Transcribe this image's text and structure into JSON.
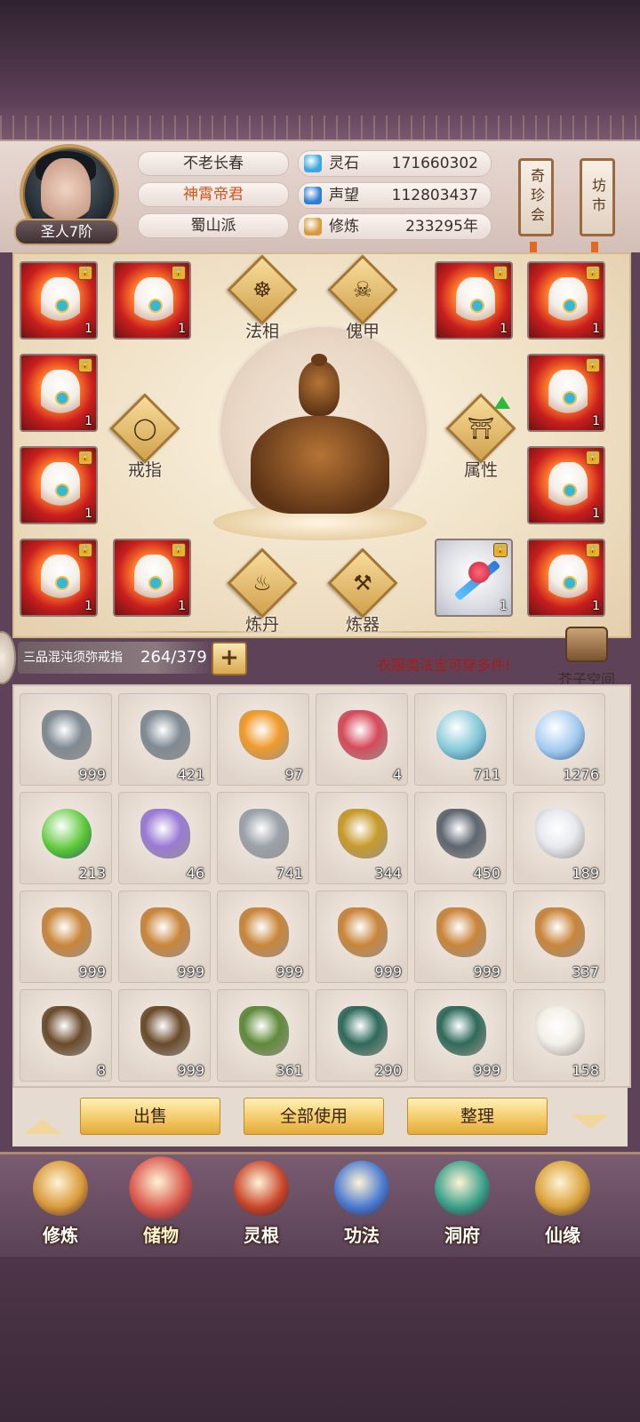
{
  "player": {
    "rank": "圣人7阶",
    "names": [
      "不老长春",
      "神霄帝君",
      "蜀山派"
    ],
    "name_colors": [
      "#3a2e2a",
      "#d2541c",
      "#3a2e2a"
    ]
  },
  "stats": [
    {
      "label": "灵石",
      "value": "171660302",
      "icon": "spirit-stone-icon",
      "color": "#3aa7e0"
    },
    {
      "label": "声望",
      "value": "112803437",
      "icon": "reputation-crystal-icon",
      "color": "#2f7fd0"
    },
    {
      "label": "修炼",
      "value": "233295年",
      "icon": "cultivation-meditation-icon",
      "color": "#d69b3c"
    }
  ],
  "side_buttons": [
    {
      "label": "奇珍会",
      "icon": "treasure-fair-scroll"
    },
    {
      "label": "坊市",
      "icon": "market-scroll"
    }
  ],
  "equip_functions": [
    {
      "label": "法相",
      "glyph": "☸"
    },
    {
      "label": "傀甲",
      "glyph": "☠"
    },
    {
      "label": "戒指",
      "glyph": "◯"
    },
    {
      "label": "属性",
      "glyph": "⛩"
    },
    {
      "label": "炼丹",
      "glyph": "♨"
    },
    {
      "label": "炼器",
      "glyph": "⚒"
    }
  ],
  "equip_slots": {
    "count_label": "1",
    "lock_glyph": "🔒"
  },
  "capacity": {
    "ring_name": "三品混沌须弥戒指",
    "count": "264/379",
    "plus": "+"
  },
  "hint_text": "衣服类法宝可穿多件!",
  "space_button": "芥子空间",
  "inventory": [
    {
      "icon": "iron-ore-shards-icon",
      "qty": "999",
      "color": "#7f8a94"
    },
    {
      "icon": "iron-ore-shards-icon",
      "qty": "421",
      "color": "#7f8a94"
    },
    {
      "icon": "amber-crystal-shards-icon",
      "qty": "97",
      "color": "#f09a2a"
    },
    {
      "icon": "red-treasure-chest-icon",
      "qty": "4",
      "color": "#d64a5a"
    },
    {
      "icon": "cyan-spirit-orb-icon",
      "qty": "711",
      "color": "#7fc6d6"
    },
    {
      "icon": "blue-spirit-orb-icon",
      "qty": "1276",
      "color": "#9fc8f0"
    },
    {
      "icon": "green-spirit-orb-icon",
      "qty": "213",
      "color": "#58c634"
    },
    {
      "icon": "purple-cloud-icon",
      "qty": "46",
      "color": "#9a7ad6"
    },
    {
      "icon": "silver-ore-icon",
      "qty": "741",
      "color": "#9ba2aa"
    },
    {
      "icon": "gold-ore-icon",
      "qty": "344",
      "color": "#c79a2a"
    },
    {
      "icon": "dark-iron-ore-icon",
      "qty": "450",
      "color": "#5e6670"
    },
    {
      "icon": "white-lily-icon",
      "qty": "189",
      "color": "#e8eaf0"
    },
    {
      "icon": "ginseng-root-icon",
      "qty": "999",
      "color": "#c9853a"
    },
    {
      "icon": "ginseng-root-icon",
      "qty": "999",
      "color": "#c9853a"
    },
    {
      "icon": "ginseng-root-icon",
      "qty": "999",
      "color": "#c9853a"
    },
    {
      "icon": "ginseng-root-icon",
      "qty": "999",
      "color": "#c9853a"
    },
    {
      "icon": "ginseng-root-icon",
      "qty": "999",
      "color": "#c9853a"
    },
    {
      "icon": "ginseng-root-icon",
      "qty": "337",
      "color": "#c9853a"
    },
    {
      "icon": "herb-tuber-icon",
      "qty": "8",
      "color": "#6a4a2a"
    },
    {
      "icon": "herb-tuber-icon",
      "qty": "999",
      "color": "#6a4a2a"
    },
    {
      "icon": "flowering-herb-icon",
      "qty": "361",
      "color": "#5f8a3a"
    },
    {
      "icon": "berry-branch-icon",
      "qty": "290",
      "color": "#2e6a5a"
    },
    {
      "icon": "berry-branch-icon",
      "qty": "999",
      "color": "#2e6a5a"
    },
    {
      "icon": "white-daisy-icon",
      "qty": "158",
      "color": "#f3f0e8"
    }
  ],
  "actions": [
    "出售",
    "全部使用",
    "整理"
  ],
  "nav": [
    {
      "label": "修炼",
      "icon": "cultivator-icon",
      "color": "#d99a3a"
    },
    {
      "label": "储物",
      "icon": "storage-bag-icon",
      "color": "#d9554a"
    },
    {
      "label": "灵根",
      "icon": "spirit-root-icon",
      "color": "#c9462a"
    },
    {
      "label": "功法",
      "icon": "technique-book-icon",
      "color": "#4a7ad0"
    },
    {
      "label": "洞府",
      "icon": "cave-mansion-icon",
      "color": "#3aa08a"
    },
    {
      "label": "仙缘",
      "icon": "gourd-icon",
      "color": "#d9a23a"
    }
  ]
}
